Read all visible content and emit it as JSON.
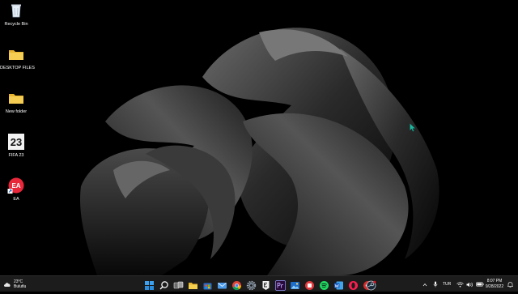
{
  "desktop": {
    "icons": [
      {
        "label": "Recycle Bin",
        "icon": "recycle-bin-icon"
      },
      {
        "label": "DESKTOP FILES",
        "icon": "folder-icon"
      },
      {
        "label": "New folder",
        "icon": "folder-icon"
      },
      {
        "label": "FIFA 23",
        "icon": "fifa-23-icon",
        "badge": "23"
      },
      {
        "label": "EA",
        "icon": "ea-app-icon",
        "badge": "EA"
      }
    ]
  },
  "taskbar": {
    "weather": {
      "temp": "23°C",
      "condition": "Bulutlu"
    },
    "pinned": [
      "start-icon",
      "search-icon",
      "task-view-icon",
      "file-explorer-icon",
      "store-icon",
      "mail-icon",
      "chrome-icon",
      "settings-icon",
      "epic-games-icon",
      "premiere-pro-icon",
      "photos-icon",
      "office-icon",
      "spotify-icon",
      "word-icon",
      "opera-gx-icon",
      "app-icon",
      "steam-icon"
    ],
    "tray": {
      "language": "TUR",
      "time": "8:07 PM",
      "date": "9/28/2022"
    }
  },
  "colors": {
    "taskbar": "#1c1c1c",
    "accent": "#0078d4",
    "cursor": "#1fb8a0"
  }
}
